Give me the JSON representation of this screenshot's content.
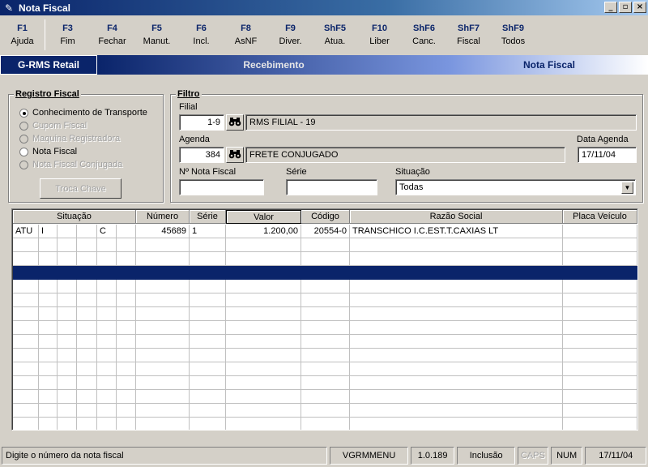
{
  "window": {
    "title": "Nota Fiscal",
    "minimize": "_",
    "maximize": "▫",
    "close": "×"
  },
  "fkeys": [
    {
      "key": "F1",
      "label": "Ajuda"
    },
    {
      "key": "F3",
      "label": "Fim"
    },
    {
      "key": "F4",
      "label": "Fechar"
    },
    {
      "key": "F5",
      "label": "Manut."
    },
    {
      "key": "F6",
      "label": "Incl."
    },
    {
      "key": "F8",
      "label": "AsNF"
    },
    {
      "key": "F9",
      "label": "Diver."
    },
    {
      "key": "ShF5",
      "label": "Atua."
    },
    {
      "key": "F10",
      "label": "Liber"
    },
    {
      "key": "ShF6",
      "label": "Canc."
    },
    {
      "key": "ShF7",
      "label": "Fiscal"
    },
    {
      "key": "ShF9",
      "label": "Todos"
    }
  ],
  "banner": {
    "app": "G-RMS Retail",
    "module": "Recebimento",
    "screen": "Nota Fiscal"
  },
  "registro": {
    "title": "Registro Fiscal",
    "options": [
      {
        "label": "Conhecimento de Transporte",
        "checked": true,
        "enabled": true
      },
      {
        "label": "Cupom Fiscal",
        "checked": false,
        "enabled": false
      },
      {
        "label": "Maquina Registradora",
        "checked": false,
        "enabled": false
      },
      {
        "label": "Nota Fiscal",
        "checked": false,
        "enabled": true
      },
      {
        "label": "Nota Fiscal Conjugada",
        "checked": false,
        "enabled": false
      }
    ],
    "troca_chave": "Troca Chave"
  },
  "filtro": {
    "title": "Filtro",
    "filial_label": "Filial",
    "filial_code": "1-9",
    "filial_name": "RMS FILIAL - 19",
    "agenda_label": "Agenda",
    "agenda_code": "384",
    "agenda_name": "FRETE CONJUGADO",
    "data_agenda_label": "Data Agenda",
    "data_agenda": "17/11/04",
    "nf_label": "Nº Nota Fiscal",
    "nf_value": "",
    "serie_label": "Série",
    "serie_value": "",
    "situacao_label": "Situação",
    "situacao_value": "Todas"
  },
  "grid": {
    "headers": [
      "Situação",
      "Número",
      "Série",
      "Valor",
      "Código",
      "Razão Social",
      "Placa Veículo"
    ],
    "rows": [
      {
        "s1": "ATU",
        "s2": "I",
        "s3": "",
        "s4": "",
        "s5": "C",
        "s6": "",
        "numero": "45689",
        "serie": "1",
        "valor": "1.200,00",
        "codigo": "20554-0",
        "razao": "TRANSCHICO I.C.EST.T.CAXIAS LT",
        "placa": ""
      }
    ]
  },
  "status": {
    "message": "Digite o número da nota fiscal",
    "menu": "VGRMMENU",
    "version": "1.0.189",
    "mode": "Inclusão",
    "caps": "CAPS",
    "num": "NUM",
    "date": "17/11/04"
  }
}
